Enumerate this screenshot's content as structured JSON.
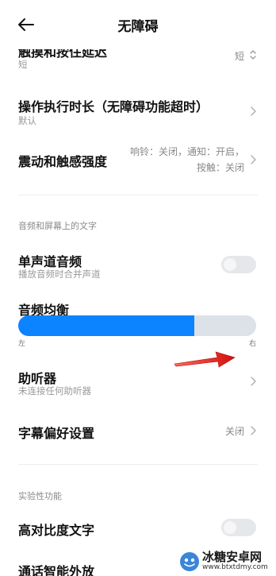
{
  "header": {
    "title": "无障碍"
  },
  "rows": {
    "touch_delay": {
      "title": "触摸和按住延迟",
      "sub": "短",
      "value": "短"
    },
    "action_time": {
      "title": "操作执行时长（无障碍功能超时）",
      "sub": "默认"
    },
    "vibration": {
      "title": "震动和触感强度",
      "value_line1": "响铃：关闭，通知：开启，",
      "value_line2": "按触：关闭"
    },
    "mono_audio": {
      "title": "单声道音频",
      "sub": "播放音频时合并声道",
      "enabled": false
    },
    "audio_balance": {
      "title": "音频均衡",
      "left_label": "左",
      "right_label": "右",
      "level_fraction": 0.74
    },
    "hearing_aids": {
      "title": "助听器",
      "sub": "未连接任何助听器"
    },
    "captions": {
      "title": "字幕偏好设置",
      "value": "关闭"
    },
    "high_contrast": {
      "title": "高对比度文字",
      "enabled": false
    },
    "partial_next": {
      "title": "通话智能外放"
    }
  },
  "sections": {
    "audio_text": "音频和屏幕上的文字",
    "experimental": "实验性功能"
  },
  "watermark": {
    "name": "冰糖安卓网",
    "url": "www.btxtdmy.com"
  },
  "colors": {
    "accent": "#0d84ff",
    "arrow": "#e0201c"
  },
  "icons": {
    "back": "back-arrow-icon",
    "chevron": "chevron-right-icon",
    "stepper": "up-down-chevron-icon"
  }
}
